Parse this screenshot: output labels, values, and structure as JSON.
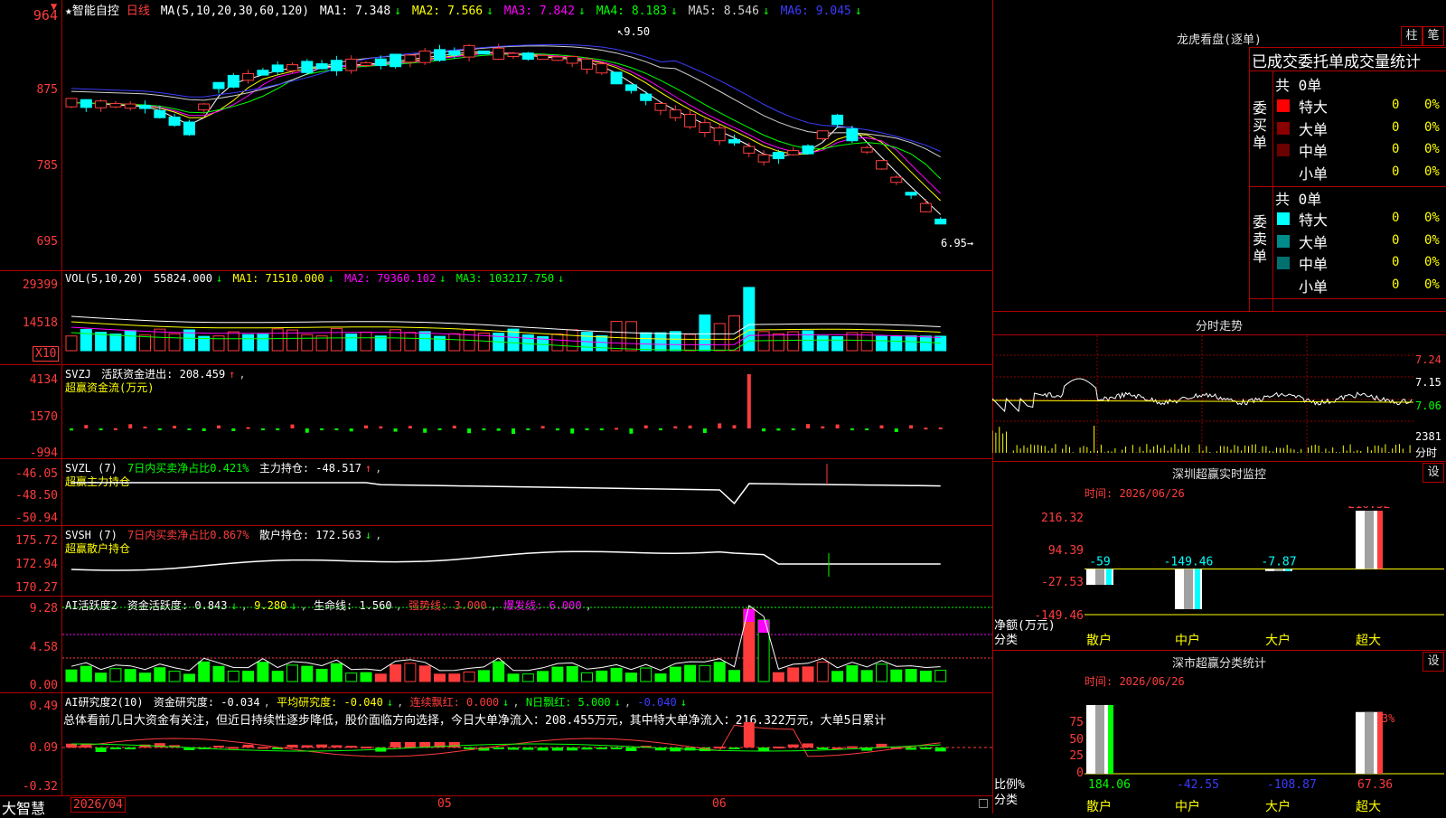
{
  "main": {
    "name_label": "智能自控",
    "period": "日线",
    "ma_legend": {
      "title": "MA(5,10,20,30,60,120)",
      "ma1": "MA1: 7.348",
      "ma2": "MA2: 7.566",
      "ma3": "MA3: 7.842",
      "ma4": "MA4: 8.183",
      "ma5": "MA5: 8.546",
      "ma6": "MA6: 9.045"
    },
    "y_ticks": [
      "964",
      "875",
      "785",
      "695"
    ],
    "high_label": "9.50",
    "low_label": "6.95"
  },
  "vol": {
    "title": "VOL(5,10,20)",
    "value": "55824.000",
    "ma1": "MA1: 71510.000",
    "ma2": "MA2: 79360.102",
    "ma3": "MA3: 103217.750",
    "y_ticks": [
      "29399",
      "14518"
    ],
    "unit": "X10"
  },
  "svzj": {
    "title": "SVZJ",
    "label": "活跃资金进出: 208.459",
    "sub": "超赢资金流(万元)",
    "y_ticks": [
      "4134",
      "1570",
      "-994"
    ]
  },
  "svzl": {
    "title": "SVZL (7)",
    "ratio": "7日内买卖净占比0.421%",
    "pos": "主力持仓: -48.517",
    "sub": "超赢主力持仓",
    "y_ticks": [
      "-46.05",
      "-48.50",
      "-50.94"
    ]
  },
  "svsh": {
    "title": "SVSH (7)",
    "ratio": "7日内买卖净占比0.867%",
    "pos": "散户持仓: 172.563",
    "sub": "超赢散户持仓",
    "y_ticks": [
      "175.72",
      "172.94",
      "170.27"
    ]
  },
  "ai1": {
    "title": "AI活跃度2",
    "active": "资金活跃度: 0.843",
    "v2": "9.280",
    "life": "生命线: 1.560",
    "strong": "强势线: 3.000",
    "burst": "爆发线: 6.000",
    "y_ticks": [
      "9.28",
      "4.58",
      "0.00"
    ]
  },
  "ai2": {
    "title": "AI研究度2(10)",
    "research": "资金研究度: -0.034",
    "avg": "平均研究度: -0.040",
    "red": "连续飘红: 0.000",
    "nred": "N日飘红: 5.000",
    "last": "-0.040",
    "y_ticks": [
      "0.49",
      "0.09",
      "-0.32"
    ],
    "summary": "总体看前几日大资金有关注，但近日持续性逐步降低，股价面临方向选择，今日大单净流入：208.455万元，其中特大单净流入：216.322万元，大单5日累计"
  },
  "footer": {
    "brand": "大智慧",
    "date": "2026/04",
    "m05": "05",
    "m06": "06"
  },
  "dragon": {
    "title": "龙虎看盘(逐单)",
    "btn1": "柱",
    "btn2": "笔",
    "header": "已成交委托单成交量统计",
    "buy": {
      "side": "委买单",
      "total": "共 0单",
      "rows": [
        {
          "label": "特大",
          "n": "0",
          "p": "0%",
          "color": "#ff0000"
        },
        {
          "label": "大单",
          "n": "0",
          "p": "0%",
          "color": "#8b0000"
        },
        {
          "label": "中单",
          "n": "0",
          "p": "0%",
          "color": "#6b0000"
        },
        {
          "label": "小单",
          "n": "0",
          "p": "0%",
          "color": "#000000"
        }
      ]
    },
    "sell": {
      "side": "委卖单",
      "total": "共 0单",
      "rows": [
        {
          "label": "特大",
          "n": "0",
          "p": "0%",
          "color": "#00ffff"
        },
        {
          "label": "大单",
          "n": "0",
          "p": "0%",
          "color": "#008b8b"
        },
        {
          "label": "中单",
          "n": "0",
          "p": "0%",
          "color": "#007070"
        },
        {
          "label": "小单",
          "n": "0",
          "p": "0%",
          "color": "#000000"
        }
      ]
    }
  },
  "intraday": {
    "title": "分时走势",
    "y_ticks": [
      "7.24",
      "7.15",
      "7.06",
      "2381"
    ],
    "vol_label": "分时"
  },
  "monitor": {
    "title": "深圳超赢实时监控",
    "btn": "设",
    "time": "时间: 2026/06/26",
    "y_ticks": [
      "216.32",
      "94.39",
      "-27.53",
      "-149.46"
    ],
    "ylabel": "净额(万元)",
    "xlabel": "分类",
    "chart_data": {
      "type": "bar",
      "categories": [
        "散户",
        "中户",
        "大户",
        "超大"
      ],
      "values": [
        -59,
        -149.46,
        -7.87,
        216.32
      ],
      "ylim": [
        -149.46,
        216.32
      ]
    },
    "labels": [
      "-59",
      "-149.46",
      "-7.87",
      "216.32"
    ]
  },
  "stats": {
    "title": "深市超赢分类统计",
    "btn": "设",
    "time": "时间: 2026/06/26",
    "y_ticks": [
      "75",
      "50",
      "25",
      "0"
    ],
    "ylabel": "比例%",
    "xlabel": "分类",
    "top_label": "+0.13%",
    "chart_data": {
      "type": "bar",
      "categories": [
        "散户",
        "中户",
        "大户",
        "超大"
      ],
      "values": [
        184.06,
        -42.55,
        -108.87,
        67.36
      ],
      "ylim": [
        0,
        75
      ]
    },
    "labels": [
      "184.06",
      "-42.55",
      "-108.87",
      "67.36"
    ]
  }
}
